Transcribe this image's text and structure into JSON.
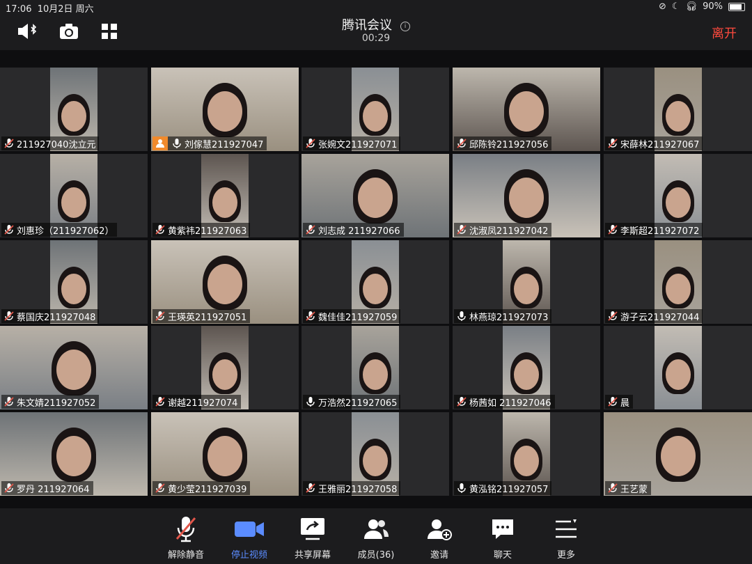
{
  "status_bar": {
    "time": "17:06",
    "date": "10月2日 周六",
    "battery": "90%",
    "battery_level": 0.9
  },
  "header": {
    "title": "腾讯会议",
    "timer": "00:29",
    "leave": "离开"
  },
  "participants": [
    {
      "name": "211927040沈立元",
      "muted": true,
      "host": false
    },
    {
      "name": "刘傢慧211927047",
      "muted": false,
      "host": true
    },
    {
      "name": "张婉文211927071",
      "muted": true,
      "host": false
    },
    {
      "name": "邱陈铃211927056",
      "muted": true,
      "host": false
    },
    {
      "name": "宋薛林211927067",
      "muted": true,
      "host": false
    },
    {
      "name": "刘惠珍（211927062）",
      "muted": true,
      "host": false
    },
    {
      "name": "黄紫祎211927063",
      "muted": true,
      "host": false
    },
    {
      "name": "刘志成 211927066",
      "muted": true,
      "host": false
    },
    {
      "name": "沈淑凤211927042",
      "muted": true,
      "host": false
    },
    {
      "name": "李斯超211927072",
      "muted": true,
      "host": false
    },
    {
      "name": "蔡国庆211927048",
      "muted": true,
      "host": false
    },
    {
      "name": "王瑛英211927051",
      "muted": true,
      "host": false
    },
    {
      "name": "魏佳佳211927059",
      "muted": true,
      "host": false
    },
    {
      "name": "林燕琼211927073",
      "muted": false,
      "host": false
    },
    {
      "name": "游子云211927044",
      "muted": true,
      "host": false
    },
    {
      "name": "朱文婧211927052",
      "muted": true,
      "host": false
    },
    {
      "name": "谢越211927074",
      "muted": true,
      "host": false
    },
    {
      "name": "万浩然211927065",
      "muted": false,
      "host": false
    },
    {
      "name": "杨茜如 211927046",
      "muted": true,
      "host": false
    },
    {
      "name": "晨",
      "muted": true,
      "host": false
    },
    {
      "name": "罗丹 211927064",
      "muted": true,
      "host": false
    },
    {
      "name": "黄少莹211927039",
      "muted": true,
      "host": false
    },
    {
      "name": "王雅丽211927058",
      "muted": true,
      "host": false
    },
    {
      "name": "黄泓铭211927057",
      "muted": false,
      "host": false
    },
    {
      "name": "王艺蒙",
      "muted": true,
      "host": false
    }
  ],
  "toolbar": {
    "unmute": "解除静音",
    "stop_video": "停止视频",
    "share_screen": "共享屏幕",
    "members": "成员(36)",
    "invite": "邀请",
    "chat": "聊天",
    "more": "更多"
  },
  "icons": [
    "speaker-bluetooth-icon",
    "camera-switch-icon",
    "grid-view-icon",
    "info-icon",
    "mic-muted-icon",
    "video-camera-icon",
    "share-screen-icon",
    "members-icon",
    "invite-icon",
    "chat-icon",
    "more-icon"
  ],
  "colors": {
    "accent": "#5b8cff",
    "leave": "#ff4a3d",
    "muted": "#e2564a",
    "host": "#f08a2c"
  }
}
